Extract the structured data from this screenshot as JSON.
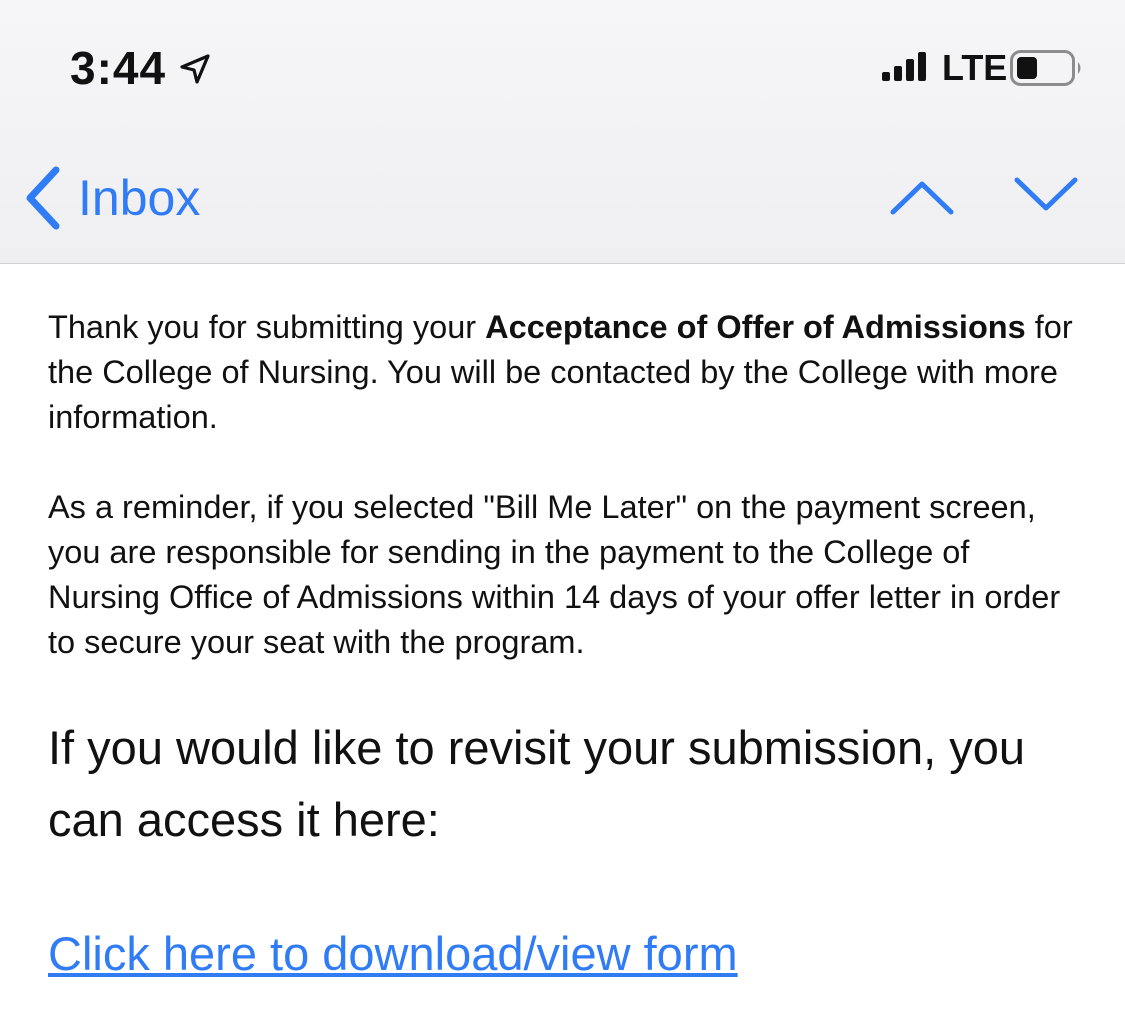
{
  "status_bar": {
    "time": "3:44",
    "location_icon": "location-arrow-icon",
    "signal_icon": "cellular-signal-icon",
    "network": "LTE",
    "battery_icon": "battery-low-icon"
  },
  "nav": {
    "back_label": "Inbox",
    "back_icon": "chevron-left-icon",
    "prev_icon": "chevron-up-icon",
    "next_icon": "chevron-down-icon",
    "accent_color": "#2f7cf6"
  },
  "email": {
    "p1_a": "Thank you for submitting your ",
    "p1_bold": "Acceptance of Offer of Admissions",
    "p1_b": " for the College of Nursing.  You will be contacted by the College with more information.",
    "p2": "As a reminder, if you selected \"Bill Me Later\" on the payment screen, you are responsible for sending in the payment to the College of Nursing Office of Admissions within 14 days of your offer letter in order to secure your seat with the program.",
    "revisit": "If you would like to revisit your submission, you can access it here:",
    "link_text": "Click here to download/view form"
  }
}
